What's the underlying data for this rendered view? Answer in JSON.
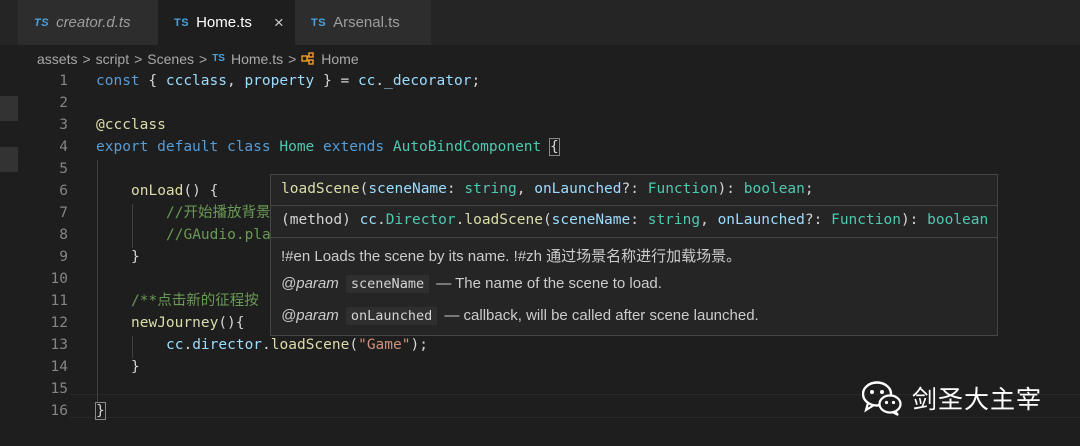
{
  "tabs": [
    {
      "prefix": "TS",
      "label": "creator.d.ts"
    },
    {
      "prefix": "TS",
      "label": "Home.ts",
      "close": "×"
    },
    {
      "prefix": "TS",
      "label": "Arsenal.ts"
    }
  ],
  "breadcrumb": {
    "items": [
      "assets",
      "script",
      "Scenes"
    ],
    "file_prefix": "TS",
    "file": "Home.ts",
    "symbol": "Home",
    "separator": ">"
  },
  "line_numbers": [
    "1",
    "2",
    "3",
    "4",
    "5",
    "6",
    "7",
    "8",
    "9",
    "10",
    "11",
    "12",
    "13",
    "14",
    "15",
    "16"
  ],
  "code": {
    "l1": {
      "a": "const",
      "b": " { ",
      "c": "ccclass",
      "d": ", ",
      "e": "property",
      "f": " } = ",
      "g": "cc",
      "h": ".",
      "i": "_decorator",
      "j": ";"
    },
    "l3": {
      "a": "@",
      "b": "ccclass"
    },
    "l4": {
      "a": "export",
      "b": " ",
      "c": "default",
      "d": " ",
      "e": "class",
      "f": " ",
      "g": "Home",
      "h": " ",
      "i": "extends",
      "j": " ",
      "k": "AutoBindComponent",
      "l": " ",
      "m": "{"
    },
    "l6": {
      "a": "onLoad",
      "b": "() {"
    },
    "l7": {
      "a": "//开始播放背景"
    },
    "l8": {
      "a": "//GAudio.pla"
    },
    "l9": {
      "a": "}"
    },
    "l11": {
      "a": "/**点击新的征程按"
    },
    "l12": {
      "a": "newJourney",
      "b": "(){"
    },
    "l13": {
      "a": "cc",
      "b": ".",
      "c": "director",
      "d": ".",
      "e": "loadScene",
      "f": "(",
      "g": "\"Game\"",
      "h": ");"
    },
    "l14": {
      "a": "}"
    },
    "l16": {
      "a": "}"
    }
  },
  "hover": {
    "signature": {
      "name": "loadScene",
      "p1": "(",
      "arg1": "sceneName",
      "c1": ": ",
      "t1": "string",
      "c2": ", ",
      "arg2": "onLaunched",
      "c3": "?: ",
      "t2": "Function",
      "c4": "): ",
      "ret": "boolean",
      "end": ";"
    },
    "method_line": {
      "a": "(method) ",
      "b": "cc",
      "c": ".",
      "d": "Director",
      "e": ".",
      "f": "loadScene",
      "g": "(",
      "h": "sceneName",
      "i": ": ",
      "j": "string",
      "k": ", ",
      "l": "onLaunched",
      "m": "?: ",
      "n": "Function",
      "o": "): ",
      "p": "boolean"
    },
    "description": "!#en Loads the scene by its name. !#zh 通过场景名称进行加载场景。",
    "params": [
      {
        "tag": "@param",
        "name": "sceneName",
        "text": "— The name of the scene to load."
      },
      {
        "tag": "@param",
        "name": "onLaunched",
        "text": "— callback, will be called after scene launched."
      }
    ]
  },
  "watermark": {
    "text": "剑圣大主宰",
    "icon": "wechat-icon"
  },
  "colors": {
    "keyword": "#569cd6",
    "variable": "#9cdcfe",
    "function": "#dcdcaa",
    "type": "#4ec9b0",
    "comment": "#6a9955",
    "string": "#ce9178"
  }
}
